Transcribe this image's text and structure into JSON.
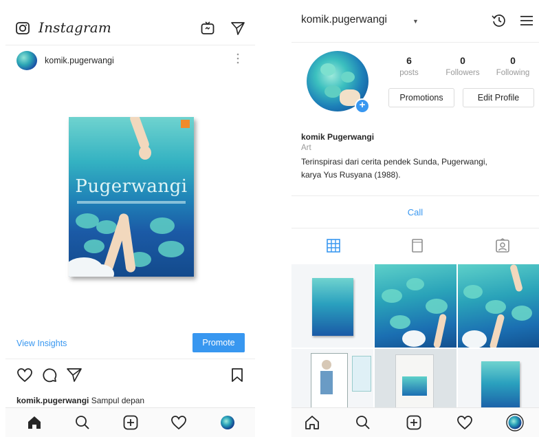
{
  "left_screen": {
    "app_name": "Instagram",
    "post": {
      "username": "komik.pugerwangi",
      "book_title": "Pugerwangi"
    },
    "view_insights_label": "View Insights",
    "promote_label": "Promote",
    "caption": {
      "username": "komik.pugerwangi",
      "text": "Sampul depan"
    }
  },
  "right_screen": {
    "username": "komik.pugerwangi",
    "stats": {
      "posts": {
        "value": "6",
        "label": "posts"
      },
      "followers": {
        "value": "0",
        "label": "Followers"
      },
      "following": {
        "value": "0",
        "label": "Following"
      }
    },
    "promotions_label": "Promotions",
    "edit_profile_label": "Edit Profile",
    "bio": {
      "name": "komik Pugerwangi",
      "category": "Art",
      "line1": "Terinspirasi dari cerita pendek Sunda, Pugerwangi,",
      "line2": "karya Yus Rusyana (1988)."
    },
    "call_label": "Call"
  },
  "icons": {
    "left_top": [
      "camera-icon",
      "igtv-icon",
      "direct-send-icon"
    ],
    "post_actions": [
      "heart-icon",
      "comment-icon",
      "share-icon",
      "bookmark-icon"
    ],
    "right_top": [
      "archive-history-icon",
      "menu-icon"
    ],
    "profile_tabs": [
      "grid-icon",
      "feed-icon",
      "tagged-icon"
    ],
    "bottom_nav": [
      "home-icon",
      "search-icon",
      "add-post-icon",
      "activity-heart-icon",
      "profile-avatar"
    ]
  },
  "colors": {
    "accent_blue": "#3897f0",
    "text_primary": "#262626",
    "text_muted": "#999999",
    "divider": "#ececec"
  }
}
